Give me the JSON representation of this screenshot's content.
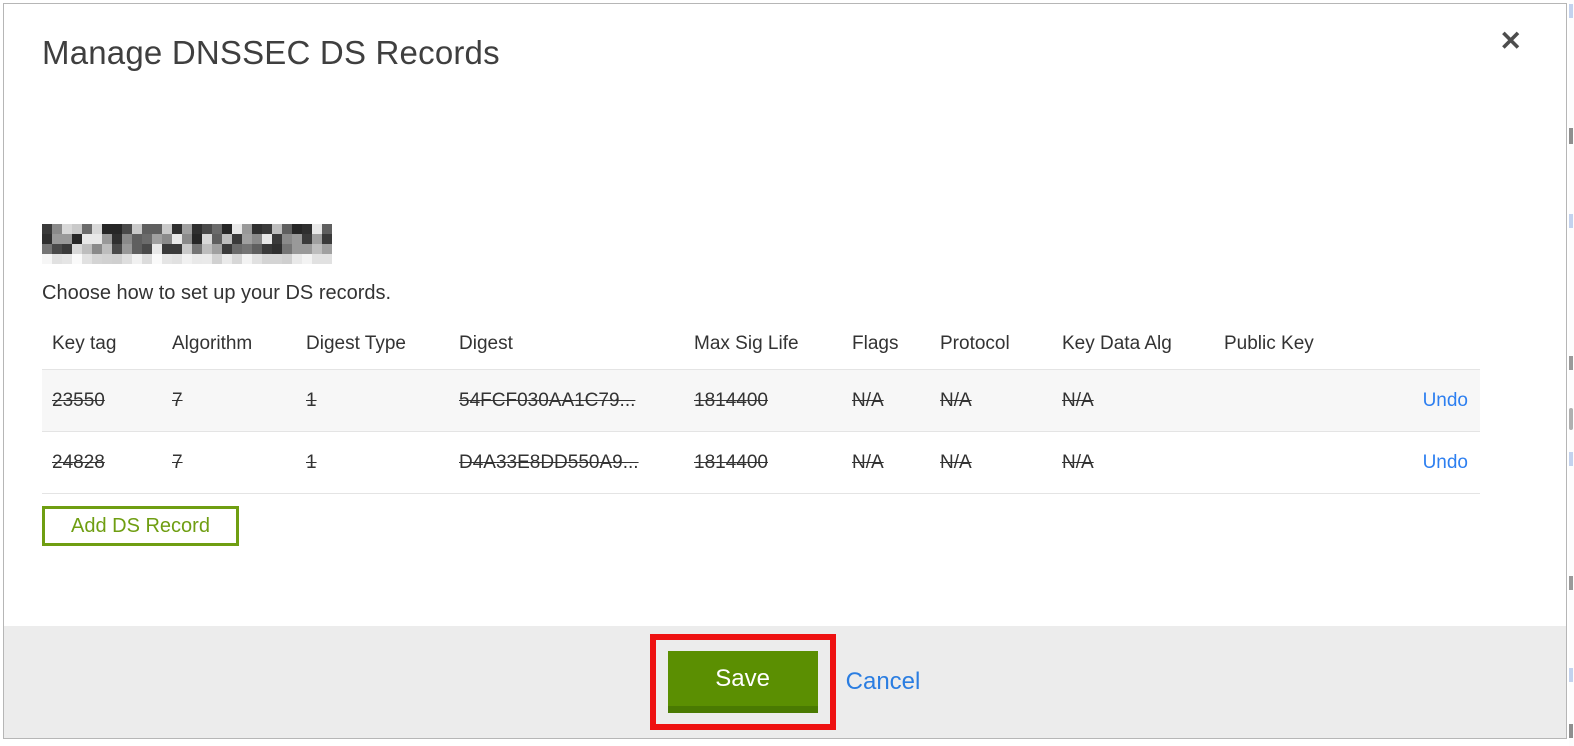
{
  "modal": {
    "title": "Manage DNSSEC DS Records",
    "close_glyph": "✕",
    "domain_redacted": true,
    "redaction_palette": [
      "#2f2f2f",
      "#4a4a4a",
      "#5f5f5f",
      "#757575",
      "#8a8a8a",
      "#a0a0a0",
      "#bdbdbd",
      "#d8d8d8",
      "#3a3a3a",
      "#6b6b6b",
      "#999999",
      "#e8e8e8",
      "#262626",
      "#c9c9c9"
    ],
    "subtitle": "Choose how to set up your DS records.",
    "table": {
      "columns": [
        "Key tag",
        "Algorithm",
        "Digest Type",
        "Digest",
        "Max Sig Life",
        "Flags",
        "Protocol",
        "Key Data Alg",
        "Public Key"
      ],
      "rows": [
        {
          "cells": [
            "23550",
            "7",
            "1",
            "54FCF030AA1C79...",
            "1814400",
            "N/A",
            "N/A",
            "N/A",
            ""
          ],
          "action": "Undo",
          "deleted": true
        },
        {
          "cells": [
            "24828",
            "7",
            "1",
            "D4A33E8DD550A9...",
            "1814400",
            "N/A",
            "N/A",
            "N/A",
            ""
          ],
          "action": "Undo",
          "deleted": true
        }
      ]
    },
    "add_button_label": "Add DS Record",
    "footer": {
      "save_label": "Save",
      "cancel_label": "Cancel"
    },
    "colors": {
      "save_green": "#5b8f02",
      "save_green_dark": "#4a7a02",
      "outline_green": "#6f9e12",
      "link_blue": "#2d7ff0",
      "cancel_blue": "#2a7de1",
      "annotation_red": "#ee1111",
      "footer_gray": "#ececec"
    }
  }
}
